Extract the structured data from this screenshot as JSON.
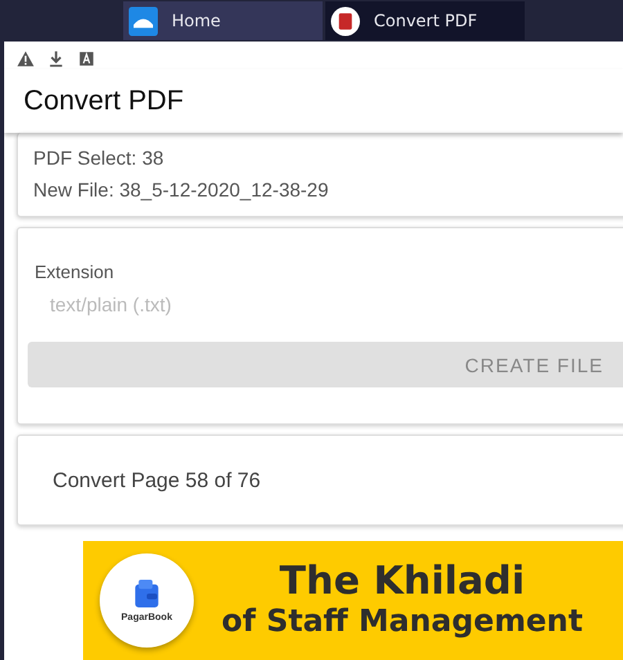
{
  "tabs": [
    {
      "label": "Home",
      "selected": false,
      "kind": "home"
    },
    {
      "label": "Convert PDF",
      "selected": true,
      "kind": "document"
    }
  ],
  "toolbar_icons": [
    {
      "kind": "warning"
    },
    {
      "kind": "download"
    },
    {
      "kind": "font"
    }
  ],
  "app_bar": {
    "title": "Convert PDF"
  },
  "info": {
    "lines": [
      "PDF Select: 38",
      "New File: 38_5-12-2020_12-38-29"
    ]
  },
  "form": {
    "label": "Extension",
    "placeholder": "text/plain (.txt)",
    "button": {
      "label": "CREATE FILE",
      "disabled": true
    }
  },
  "progress": {
    "text": "Convert Page 58 of 76"
  },
  "ad_banner": {
    "brand": "PagarBook",
    "headline": "The Khiladi",
    "subline": "of Staff Management"
  }
}
